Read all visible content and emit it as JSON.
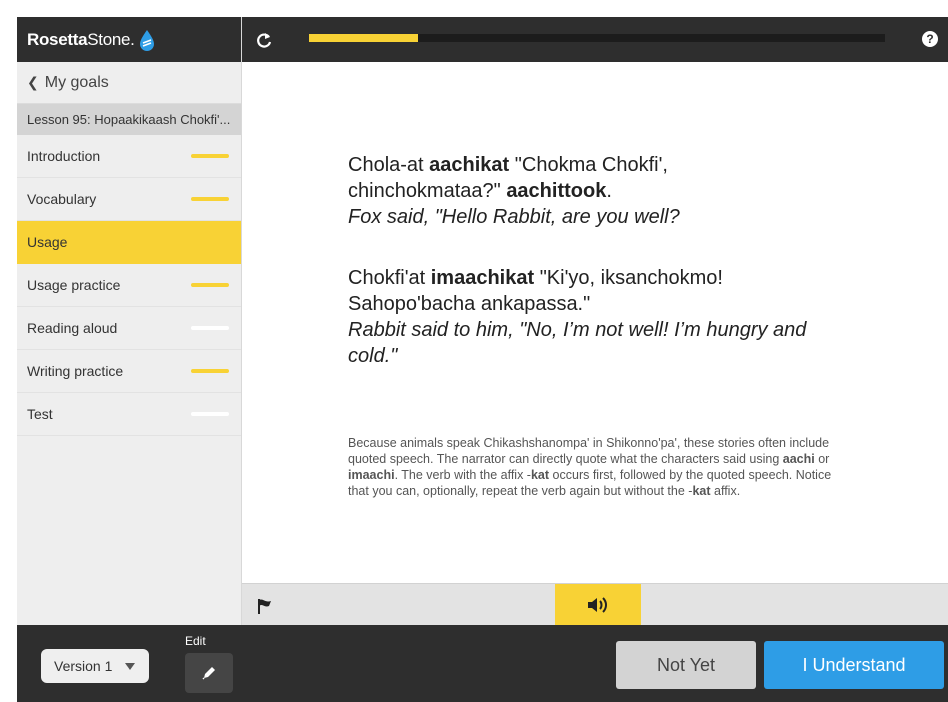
{
  "brand": {
    "name_bold": "Rosetta",
    "name_light": "Stone."
  },
  "sidebar": {
    "back_label": "My goals",
    "lesson_title": "Lesson 95: Hopaakikaash Chokfi'...",
    "items": [
      {
        "label": "Introduction",
        "progress": "partial"
      },
      {
        "label": "Vocabulary",
        "progress": "partial"
      },
      {
        "label": "Usage",
        "progress": "active"
      },
      {
        "label": "Usage practice",
        "progress": "partial"
      },
      {
        "label": "Reading aloud",
        "progress": "none"
      },
      {
        "label": "Writing practice",
        "progress": "partial"
      },
      {
        "label": "Test",
        "progress": "none"
      }
    ]
  },
  "topbar": {
    "progress_percent": 19,
    "help_label": "?"
  },
  "content": {
    "block1": {
      "seg1": "Chola-at ",
      "bold1": "aachikat",
      "seg2": " \"Chokma Chokfi', chinchokmataa?\" ",
      "bold2": "aachittook",
      "seg3": ".",
      "translation": "Fox said, \"Hello Rabbit, are you well?"
    },
    "block2": {
      "seg1": "Chokfi'at ",
      "bold1": "imaachikat",
      "seg2": " \"Ki'yo, iksanchokmo! Sahopo'bacha ankapassa.\"",
      "translation": "Rabbit said to him, \"No, I’m not well! I’m hungry and cold.\""
    },
    "note": {
      "seg1": "Because animals speak Chikashshanompa' in Shikonno'pa', these stories often include quoted speech. The narrator can directly quote what the characters said using ",
      "bold1": "aachi",
      "seg2": " or ",
      "bold2": "imaachi",
      "seg3": ". The verb with the affix -",
      "bold3": "kat",
      "seg4": " occurs first, followed by the quoted speech. Notice that you can, optionally, repeat the verb again but without the -",
      "bold4": "kat",
      "seg5": " affix."
    }
  },
  "bottom": {
    "version_label": "Version 1",
    "edit_label": "Edit",
    "not_yet_label": "Not Yet",
    "understand_label": "I Understand"
  },
  "colors": {
    "accent": "#f8d235",
    "primary": "#2e9de6",
    "dark": "#2e2e2e"
  }
}
